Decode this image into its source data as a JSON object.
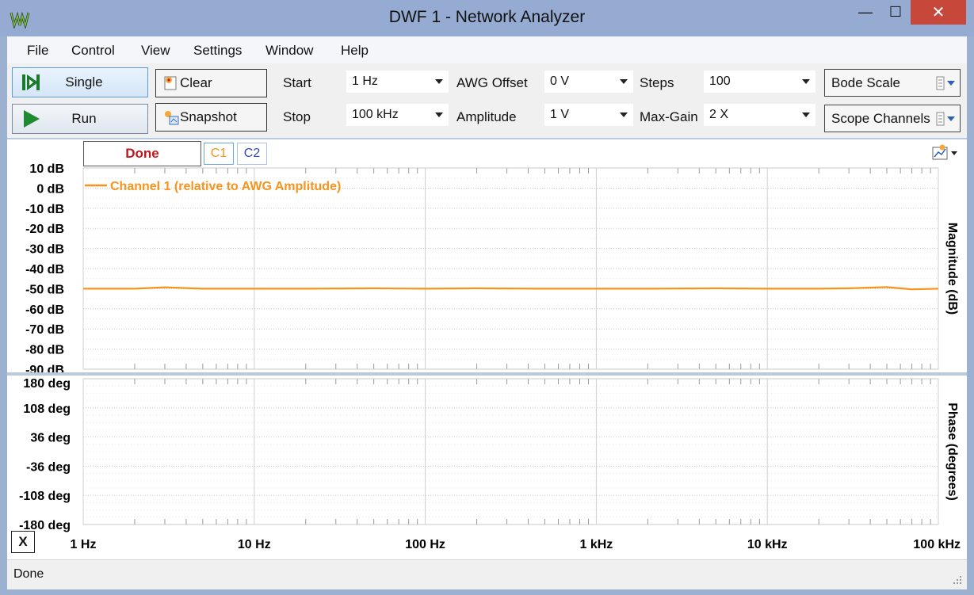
{
  "window": {
    "title": "DWF 1 - Network Analyzer",
    "minimize_glyph": "—",
    "maximize_glyph": "☐",
    "close_glyph": "✕"
  },
  "menu": [
    "File",
    "Control",
    "View",
    "Settings",
    "Window",
    "Help"
  ],
  "toolbar": {
    "single_label": "Single",
    "run_label": "Run",
    "clear_label": "Clear",
    "snapshot_label": "Snapshot",
    "start_label": "Start",
    "start_value": "1 Hz",
    "stop_label": "Stop",
    "stop_value": "100 kHz",
    "awg_offset_label": "AWG Offset",
    "awg_offset_value": "0 V",
    "amplitude_label": "Amplitude",
    "amplitude_value": "1 V",
    "steps_label": "Steps",
    "steps_value": "100",
    "max_gain_label": "Max-Gain",
    "max_gain_value": "2 X",
    "bode_scale_label": "Bode Scale",
    "scope_channels_label": "Scope Channels"
  },
  "plot": {
    "status": "Done",
    "c1_label": "C1",
    "c2_label": "C2",
    "legend": "Channel 1 (relative to AWG Amplitude)",
    "x_button": "X",
    "accent_c1": "#f7941d",
    "accent_c2": "#2b46c7",
    "status_color": "#c0171d"
  },
  "chart_data": [
    {
      "type": "line",
      "title": "",
      "ylabel": "Magnitude (dB)",
      "xscale": "log",
      "xlim": [
        1,
        100000
      ],
      "ylim": [
        -90,
        10
      ],
      "yticks": [
        "10 dB",
        "0 dB",
        "-10 dB",
        "-20 dB",
        "-30 dB",
        "-40 dB",
        "-50 dB",
        "-60 dB",
        "-70 dB",
        "-80 dB",
        "-90 dB"
      ],
      "series": [
        {
          "name": "Channel 1 (relative to AWG Amplitude)",
          "color": "#f7941d",
          "x": [
            1,
            2,
            3,
            5,
            10,
            20,
            50,
            100,
            200,
            500,
            1000,
            2000,
            5000,
            10000,
            20000,
            30000,
            50000,
            70000,
            100000
          ],
          "y": [
            -50,
            -50,
            -49.3,
            -50,
            -50,
            -50,
            -49.8,
            -50,
            -49.8,
            -50,
            -50,
            -50,
            -49.8,
            -50,
            -50,
            -49.8,
            -49.2,
            -50.3,
            -50
          ]
        }
      ],
      "grid": true
    },
    {
      "type": "line",
      "title": "",
      "ylabel": "Phase (degrees)",
      "xlabel": "",
      "xscale": "log",
      "xlim": [
        1,
        100000
      ],
      "ylim": [
        -180,
        180
      ],
      "yticks": [
        "180 deg",
        "108 deg",
        "36 deg",
        "-36 deg",
        "-108 deg",
        "-180 deg"
      ],
      "xticks": [
        "1 Hz",
        "10 Hz",
        "100 Hz",
        "1 kHz",
        "10 kHz",
        "100 kHz"
      ],
      "series": [],
      "grid": true
    }
  ],
  "statusbar": {
    "text": "Done"
  }
}
